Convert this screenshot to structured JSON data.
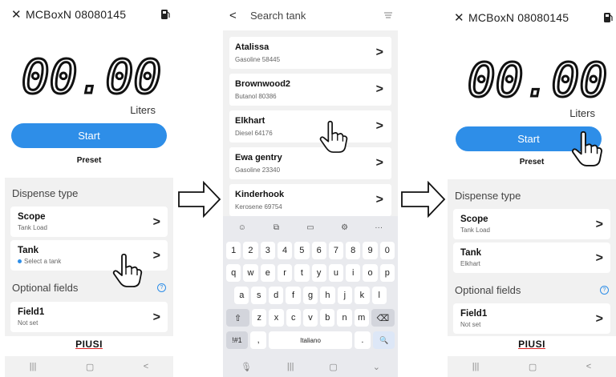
{
  "colors": {
    "accent": "#2e8ee8",
    "section_bg": "#f1f1f1",
    "keyboard_bg": "#e9eaee"
  },
  "screen1": {
    "close_icon": "close-icon",
    "title": "MCBoxN 08080145",
    "reading": "00.00",
    "units": "Liters",
    "start_label": "Start",
    "preset_label": "Preset",
    "dispense_type_label": "Dispense type",
    "scope": {
      "title": "Scope",
      "subtitle": "Tank Load"
    },
    "tank": {
      "title": "Tank",
      "subtitle": "Select a tank"
    },
    "optional_label": "Optional fields",
    "field1": {
      "title": "Field1",
      "subtitle": "Not set"
    },
    "logo": "PIUSI"
  },
  "screen2": {
    "search_placeholder": "Search tank",
    "tanks": [
      {
        "name": "Atalissa",
        "detail": "Gasoline 58445"
      },
      {
        "name": "Brownwood2",
        "detail": "Butanol 80386"
      },
      {
        "name": "Elkhart",
        "detail": "Diesel 64176"
      },
      {
        "name": "Ewa gentry",
        "detail": "Gasoline 23340"
      },
      {
        "name": "Kinderhook",
        "detail": "Kerosene 69754"
      }
    ],
    "keyboard": {
      "toolbar": [
        "☺",
        "⧉",
        "▭",
        "⚙",
        "···"
      ],
      "row1": [
        "1",
        "2",
        "3",
        "4",
        "5",
        "6",
        "7",
        "8",
        "9",
        "0"
      ],
      "row2": [
        "q",
        "w",
        "e",
        "r",
        "t",
        "y",
        "u",
        "i",
        "o",
        "p"
      ],
      "row3": [
        "a",
        "s",
        "d",
        "f",
        "g",
        "h",
        "j",
        "k",
        "l"
      ],
      "row4": [
        "z",
        "x",
        "c",
        "v",
        "b",
        "n",
        "m"
      ],
      "shift": "⇧",
      "backspace": "⌫",
      "sym": "!#1",
      "comma": ",",
      "space": "Italiano",
      "period": ".",
      "search_key": "🔍"
    }
  },
  "screen3": {
    "title": "MCBoxN 08080145",
    "reading": "00.00",
    "units": "Liters",
    "start_label": "Start",
    "preset_label": "Preset",
    "dispense_type_label": "Dispense type",
    "scope": {
      "title": "Scope",
      "subtitle": "Tank Load"
    },
    "tank": {
      "title": "Tank",
      "subtitle": "Elkhart"
    },
    "optional_label": "Optional fields",
    "field1": {
      "title": "Field1",
      "subtitle": "Not set"
    },
    "logo": "PIUSI"
  },
  "navbar": {
    "recents": "|||",
    "home": "▢",
    "back": "<"
  }
}
